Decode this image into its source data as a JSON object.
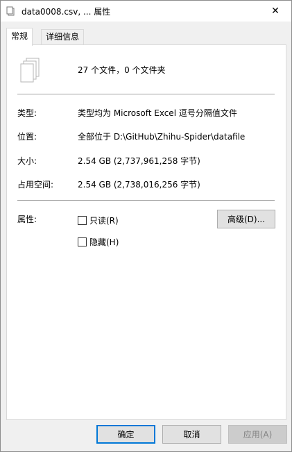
{
  "window": {
    "title": "data0008.csv, ... 属性",
    "close_symbol": "✕",
    "close_icon": "close-icon",
    "file_icon": "document-icon"
  },
  "tabs": [
    {
      "label": "常规",
      "active": true
    },
    {
      "label": "详细信息",
      "active": false
    }
  ],
  "general": {
    "summary": "27 个文件，0 个文件夹",
    "summary_icon": "multiple-files-icon",
    "rows": {
      "type": {
        "label": "类型:",
        "value": "类型均为 Microsoft Excel 逗号分隔值文件"
      },
      "location": {
        "label": "位置:",
        "value": "全部位于 D:\\GitHub\\Zhihu-Spider\\datafile"
      },
      "size": {
        "label": "大小:",
        "value": "2.54 GB (2,737,961,258 字节)"
      },
      "disk_size": {
        "label": "占用空间:",
        "value": "2.54 GB (2,738,016,256 字节)"
      }
    },
    "attributes": {
      "label": "属性:",
      "readonly": {
        "label": "只读(R)",
        "checked": false
      },
      "hidden": {
        "label": "隐藏(H)",
        "checked": false
      },
      "advanced_button": "高级(D)..."
    }
  },
  "footer": {
    "ok": "确定",
    "cancel": "取消",
    "apply": "应用(A)"
  },
  "colors": {
    "accent": "#0078d7",
    "dialog_bg": "#f0f0f0",
    "panel_bg": "#ffffff"
  }
}
